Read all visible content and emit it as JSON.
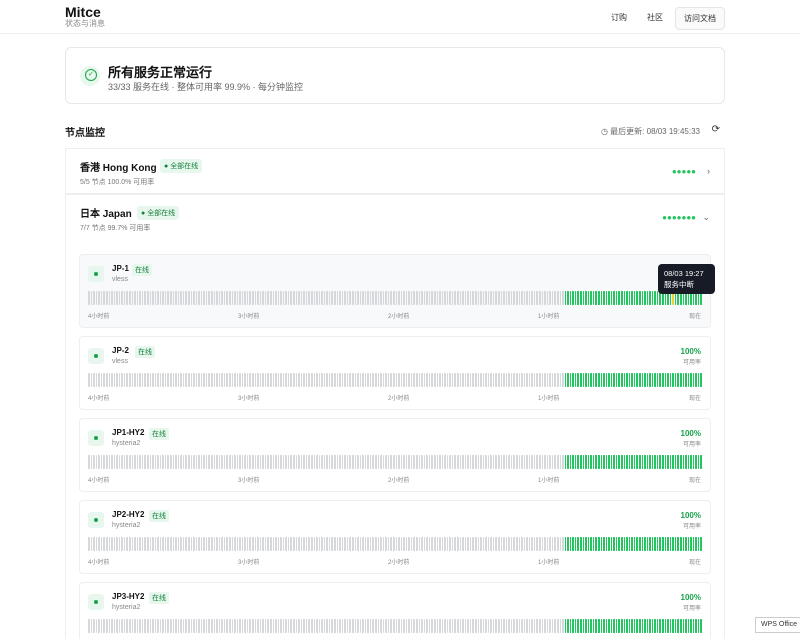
{
  "header": {
    "brand": "Mitce",
    "subtitle": "状态与消息",
    "nav": [
      "订购",
      "社区"
    ],
    "docs_button": "访问文档"
  },
  "status": {
    "title": "所有服务正常运行",
    "summary": "33/33 服务在线 · 整体可用率 99.9% · 每分钟监控"
  },
  "monitor": {
    "title": "节点监控",
    "updated": "最后更新: 08/03 19:45:33"
  },
  "regions": [
    {
      "name": "香港 Hong Kong",
      "badge": "全部在线",
      "meta": "5/5 节点    100.0% 可用率",
      "dots": "●●●●●"
    },
    {
      "name": "日本 Japan",
      "badge": "全部在线",
      "meta": "7/7 节点    99.7% 可用率",
      "dots": "●●●●●●●"
    }
  ],
  "nodes": [
    {
      "name": "JP-1",
      "badge": "在线",
      "protocol": "vless",
      "uptime": "",
      "uptime_label": "",
      "warn_index": 42
    },
    {
      "name": "JP-2",
      "badge": "在线",
      "protocol": "vless",
      "uptime": "100%",
      "uptime_label": "可用率"
    },
    {
      "name": "JP1-HY2",
      "badge": "在线",
      "protocol": "hysteria2",
      "uptime": "100%",
      "uptime_label": "可用率"
    },
    {
      "name": "JP2-HY2",
      "badge": "在线",
      "protocol": "hysteria2",
      "uptime": "100%",
      "uptime_label": "可用率"
    },
    {
      "name": "JP3-HY2",
      "badge": "在线",
      "protocol": "hysteria2",
      "uptime": "100%",
      "uptime_label": "可用率"
    }
  ],
  "axis": [
    "4小时前",
    "3小时前",
    "2小时前",
    "1小时前",
    "现在"
  ],
  "bar": {
    "total": 240,
    "up_from": 186
  },
  "tooltip": {
    "time": "08/03 19:27",
    "text": "服务中断"
  },
  "taskbar": {
    "app": "WPS Office"
  },
  "colors": {
    "up": "#22c55e",
    "down": "#d6d8db",
    "incident": "#f2cc3a"
  }
}
